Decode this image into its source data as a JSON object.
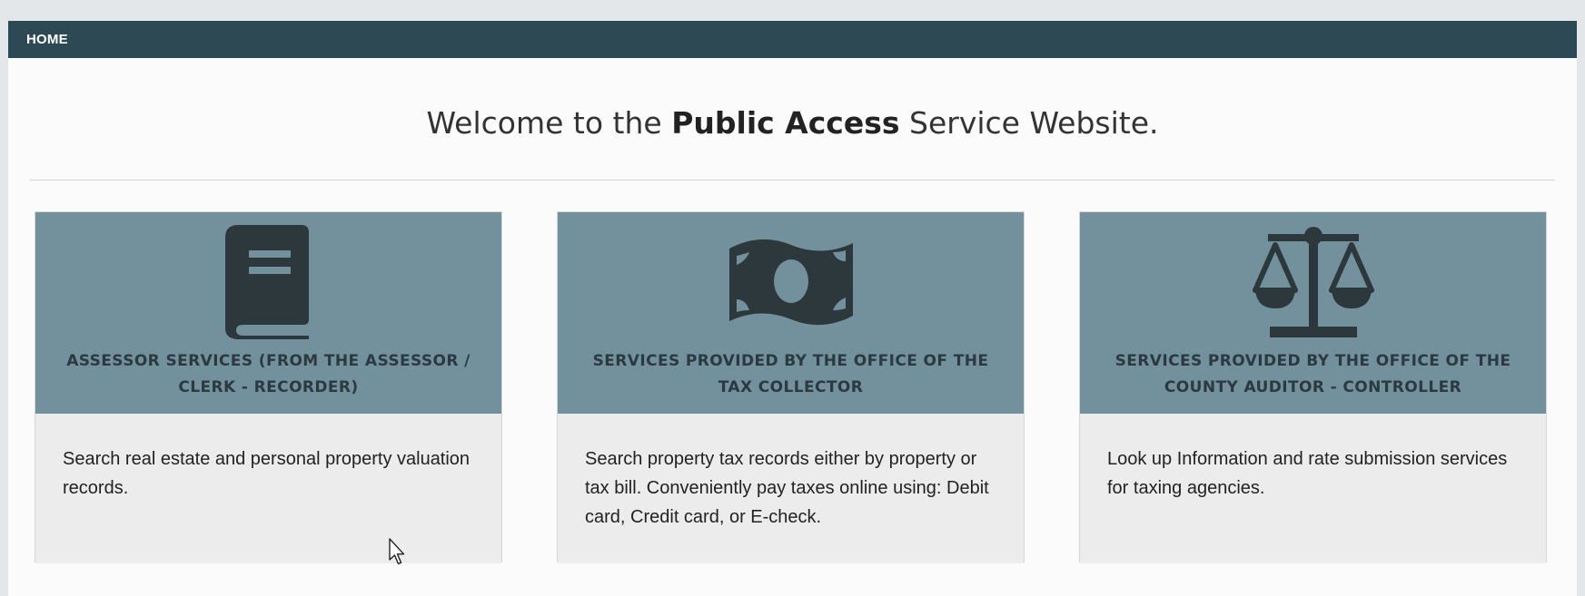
{
  "nav": {
    "home_label": "HOME"
  },
  "welcome": {
    "prefix": "Welcome to the ",
    "bold": "Public Access",
    "suffix": " Service Website."
  },
  "cards": [
    {
      "icon": "book-icon",
      "title": "ASSESSOR SERVICES (FROM THE ASSESSOR / CLERK - RECORDER)",
      "description": "Search real estate and personal property valuation records."
    },
    {
      "icon": "money-bill-icon",
      "title": "SERVICES PROVIDED BY THE OFFICE OF THE TAX COLLECTOR",
      "description": "Search property tax records either by property or tax bill. Conveniently pay taxes online using: Debit card, Credit card, or E-check."
    },
    {
      "icon": "balance-scale-icon",
      "title": "SERVICES PROVIDED BY THE OFFICE OF THE COUNTY AUDITOR - CONTROLLER",
      "description": "Look up Information and rate submission services for taxing agencies."
    }
  ],
  "colors": {
    "navbar": "#2d4954",
    "card_header": "#73919c",
    "icon": "#2d383d",
    "card_body": "#ececec"
  }
}
